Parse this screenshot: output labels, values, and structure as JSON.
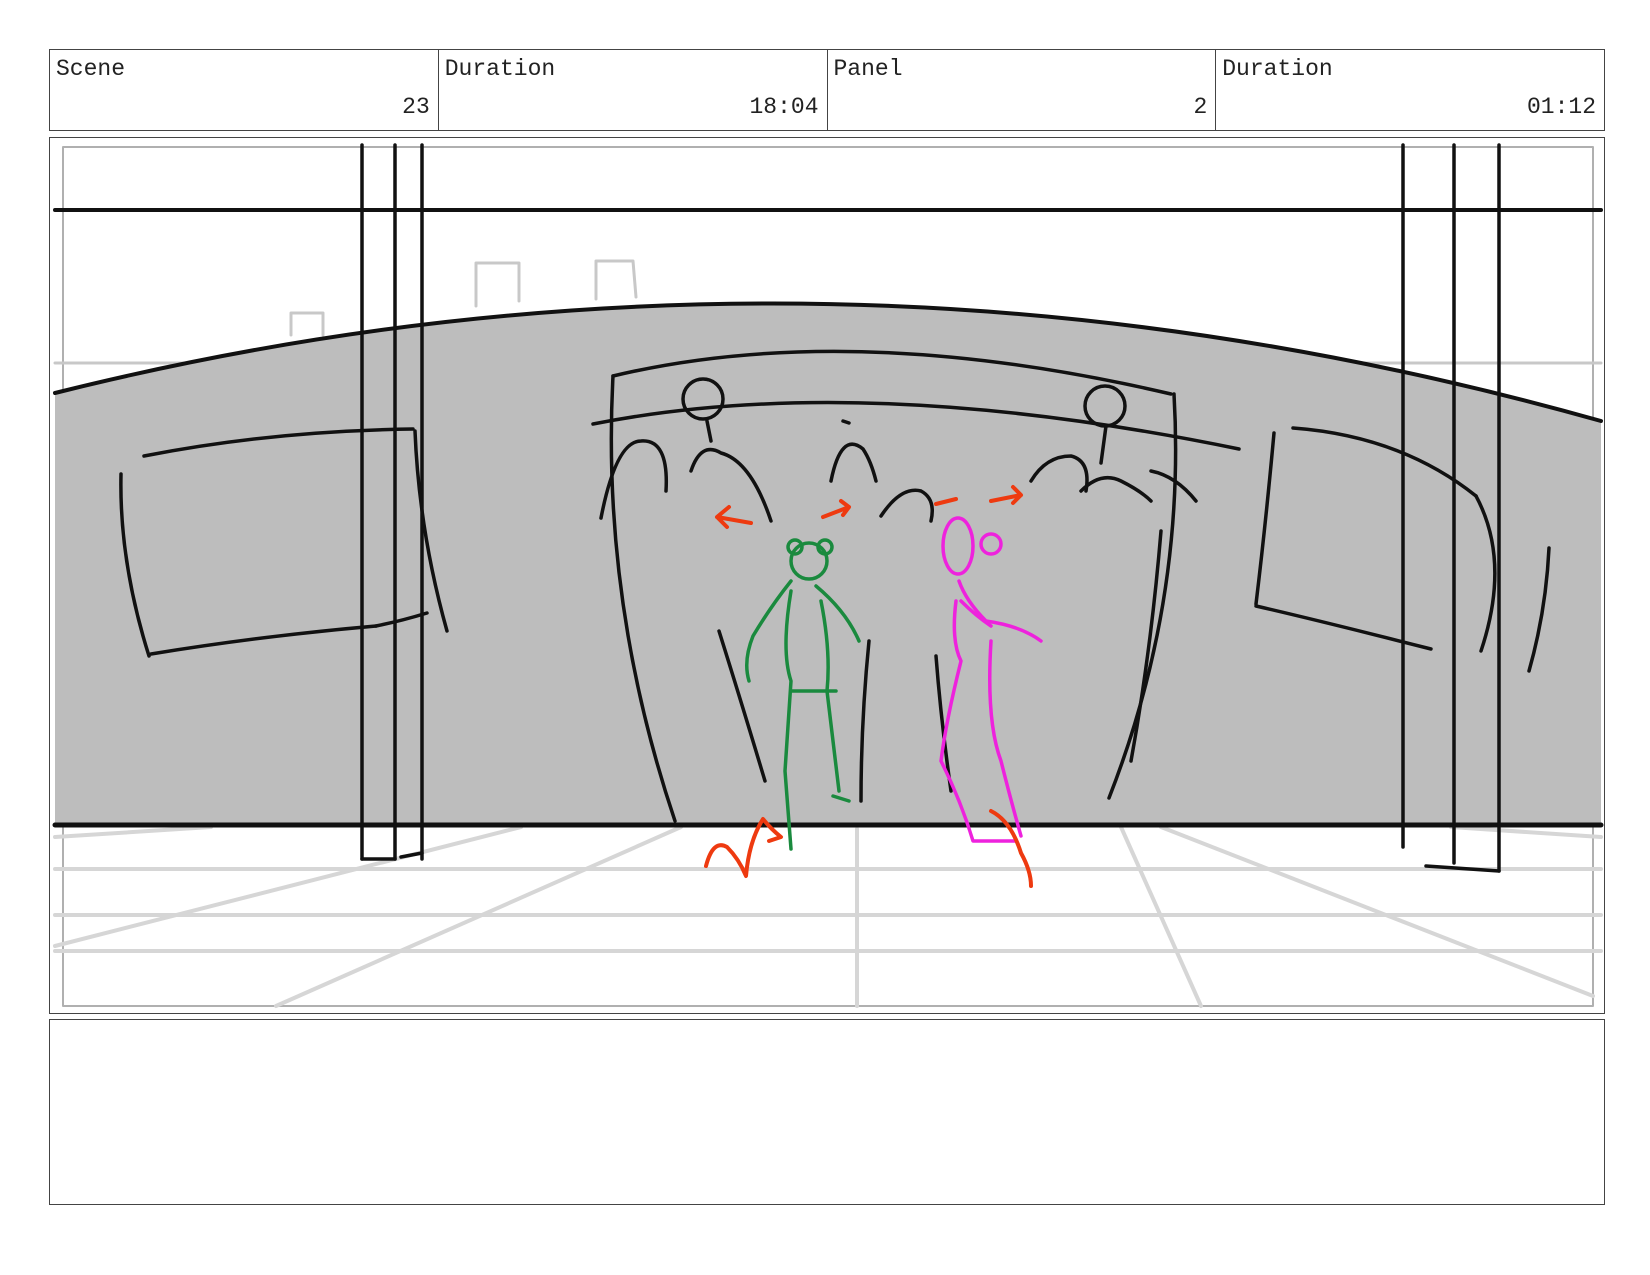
{
  "header": {
    "scene_label": "Scene",
    "scene_value": "23",
    "scene_duration_label": "Duration",
    "scene_duration_value": "18:04",
    "panel_label": "Panel",
    "panel_value": "2",
    "panel_duration_label": "Duration",
    "panel_duration_value": "01:12"
  },
  "colors": {
    "frame_border": "#444444",
    "sketch_line": "#111111",
    "fill_gray": "#bdbdbd",
    "floor_grid": "#d6d6d6",
    "character_a": "#1a8a3e",
    "character_b": "#ee22dd",
    "motion_arrows": "#ee3a10"
  },
  "notes": {
    "text": ""
  }
}
